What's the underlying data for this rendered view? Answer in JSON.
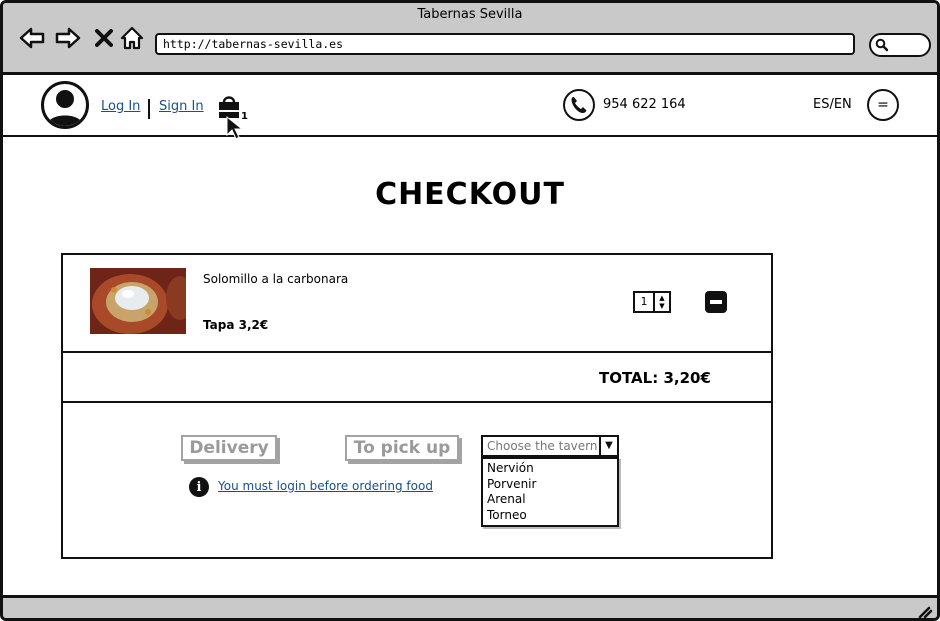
{
  "browser": {
    "title": "Tabernas Sevilla",
    "url": "http://tabernas-sevilla.es"
  },
  "header": {
    "login_label": "Log In",
    "signin_label": "Sign In",
    "cart_count": "1",
    "phone": "954 622 164",
    "lang": "ES/EN",
    "menu_symbol": "="
  },
  "page": {
    "title": "CHECKOUT"
  },
  "cart": {
    "items": [
      {
        "name": "Solomillo a la carbonara",
        "price": "Tapa 3,2€",
        "quantity": "1"
      }
    ],
    "total": "TOTAL: 3,20€"
  },
  "order": {
    "delivery_label": "Delivery",
    "pickup_label": "To pick up",
    "login_message": "You must login before ordering food",
    "tavern_placeholder": "Choose the tavern",
    "taverns": [
      "Nervión",
      "Porvenir",
      "Arenal",
      "Torneo"
    ]
  },
  "colors": {
    "chrome": "#c9c9c9",
    "link": "#1a4f87",
    "disabled": "#9a9a9a"
  }
}
